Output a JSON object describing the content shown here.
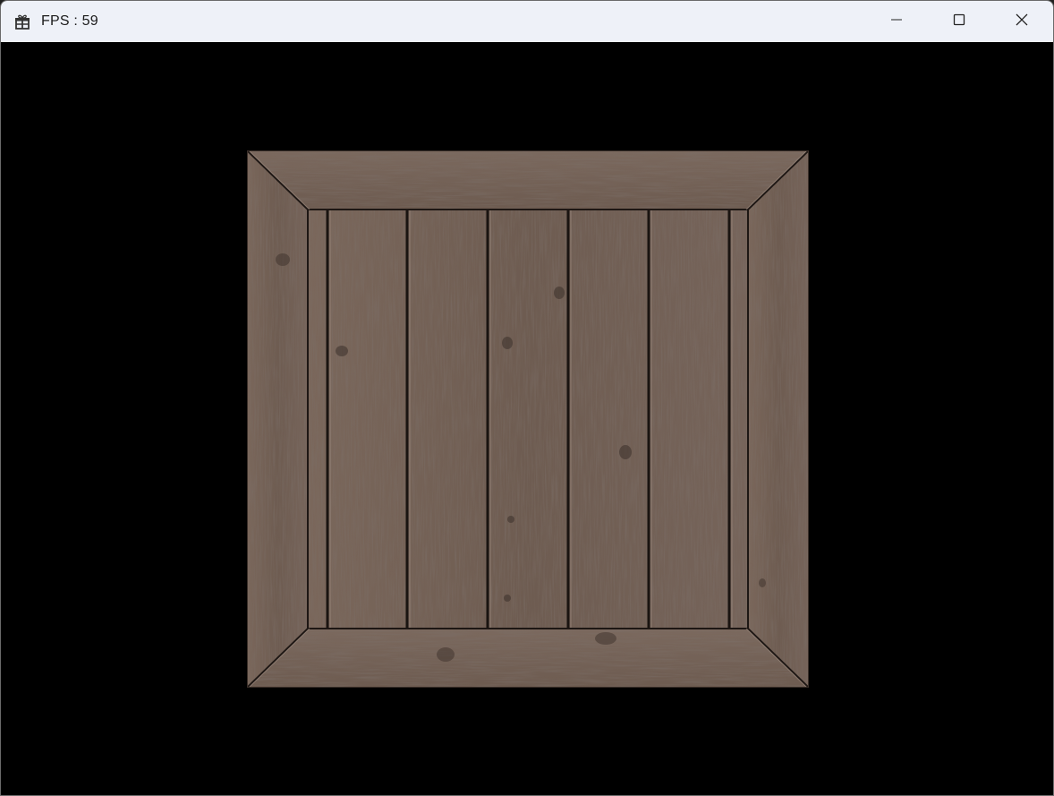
{
  "window": {
    "title": "FPS : 59",
    "app_icon": "gift-icon",
    "controls": {
      "minimize": "minimize-icon",
      "maximize": "maximize-icon",
      "close": "close-icon"
    }
  },
  "viewport": {
    "background_color": "#000000",
    "object": "wooden-crate",
    "wood_color": "#6f5c50"
  }
}
